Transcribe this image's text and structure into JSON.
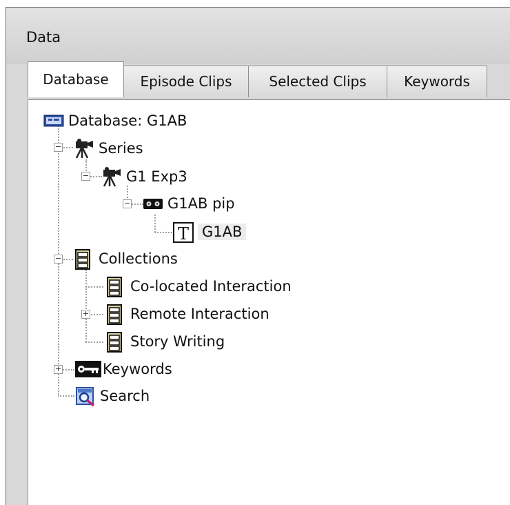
{
  "window": {
    "title": "Data"
  },
  "tabs": [
    {
      "label": "Database",
      "active": true
    },
    {
      "label": "Episode Clips",
      "active": false
    },
    {
      "label": "Selected Clips",
      "active": false
    },
    {
      "label": "Keywords",
      "active": false
    }
  ],
  "tree": {
    "root": "Database: G1AB",
    "series": "Series",
    "series_child": "G1 Exp3",
    "episode": "G1AB pip",
    "transcript": "G1AB",
    "collections": "Collections",
    "collection_1": "Co-located Interaction",
    "collection_2": "Remote Interaction",
    "collection_3": "Story Writing",
    "keywords": "Keywords",
    "search": "Search"
  },
  "icons": {
    "root": "database-icon",
    "series": "video-camera-icon",
    "episode": "video-tape-icon",
    "transcript": "text-document-icon",
    "collection": "file-cabinet-icon",
    "keywords": "key-icon",
    "search": "magnifier-search-icon"
  },
  "expanders": {
    "series": "minus",
    "series_child": "minus",
    "episode": "minus",
    "collections": "minus",
    "collection_2": "plus",
    "keywords": "plus"
  }
}
